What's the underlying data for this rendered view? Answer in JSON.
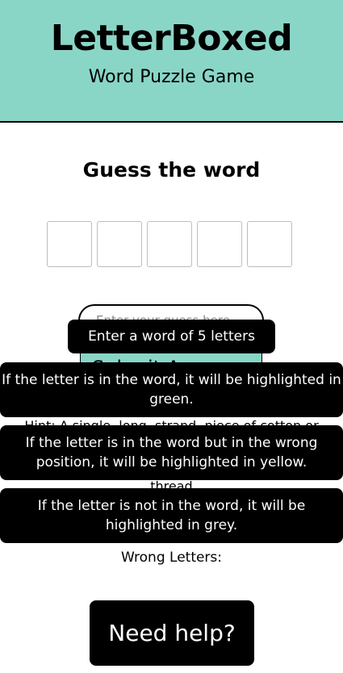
{
  "header": {
    "title": "LetterBoxed",
    "subtitle": "Word Puzzle Game"
  },
  "main": {
    "heading": "Guess the word",
    "tiles": [
      "",
      "",
      "",
      "",
      ""
    ],
    "input": {
      "placeholder": "Enter your guess here",
      "value": ""
    },
    "submit_label": "Submit Answer",
    "hint": "Hint: A single, long, strand, piece of cotton or",
    "hint_word": "thread",
    "wrong_letters_label": "Wrong Letters:",
    "help_label": "Need help?"
  },
  "toasts": [
    "Enter a word of 5 letters",
    "If the letter is in the word, it will be highlighted in green.",
    "If the letter is in the word but in the wrong position, it will be highlighted in yellow.",
    "If the letter is not in the word, it will be highlighted in grey."
  ],
  "colors": {
    "accent": "#89d6c7",
    "toast_bg": "#000000",
    "tile_border": "#bdbdbd"
  }
}
